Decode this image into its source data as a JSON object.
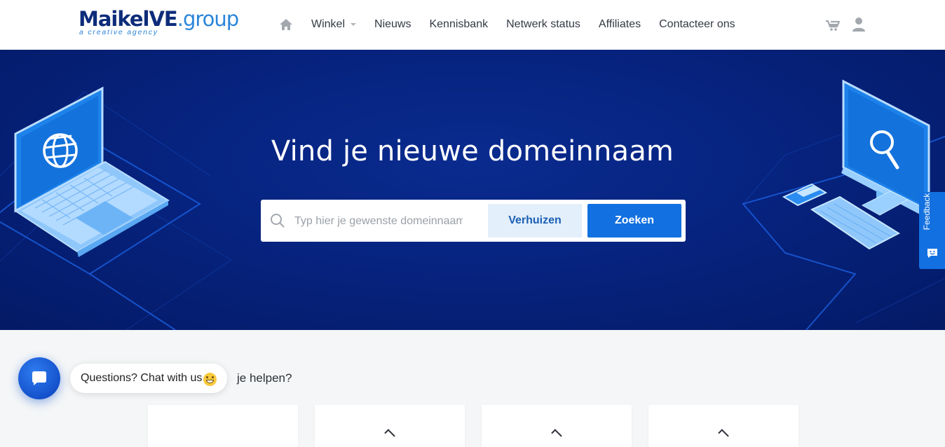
{
  "brand": {
    "name_bold": "MaikelVE",
    "name_light": ".group",
    "tagline": "a creative agency",
    "color_dark": "#0d2c7a",
    "color_light": "#2b86d9"
  },
  "nav": {
    "home_icon": "home-icon",
    "items": [
      {
        "label": "Winkel",
        "has_dropdown": true
      },
      {
        "label": "Nieuws"
      },
      {
        "label": "Kennisbank"
      },
      {
        "label": "Netwerk status"
      },
      {
        "label": "Affiliates"
      },
      {
        "label": "Contacteer ons"
      }
    ],
    "right_icons": [
      "cart-icon",
      "user-icon"
    ]
  },
  "hero": {
    "title": "Vind je nieuwe domeinnaam",
    "search_placeholder": "Typ hier je gewenste domeinnaam",
    "transfer_label": "Verhuizen",
    "search_label": "Zoeken",
    "accent": "#1270e0",
    "background": "#06237f"
  },
  "feedback": {
    "label": "Feedback",
    "icon": "smiley-chat-icon"
  },
  "section": {
    "heading_partial": "je helpen?"
  },
  "chat": {
    "prompt": "Questions? Chat with us",
    "emoji": "grinning-face-icon",
    "icon": "chat-icon"
  }
}
